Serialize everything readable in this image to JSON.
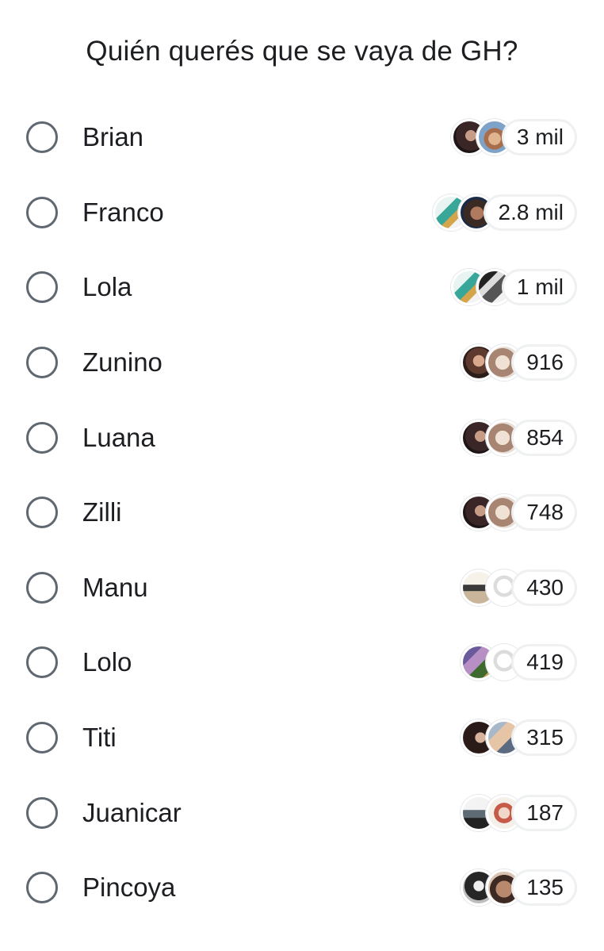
{
  "poll": {
    "question": "Quién querés que se vaya de GH?",
    "options": [
      {
        "label": "Brian",
        "count": "3 mil",
        "avatars": [
          "dark-woman",
          "blonde"
        ]
      },
      {
        "label": "Franco",
        "count": "2.8 mil",
        "avatars": [
          "chino",
          "kid"
        ]
      },
      {
        "label": "Lola",
        "count": "1 mil",
        "avatars": [
          "chino",
          "bw"
        ]
      },
      {
        "label": "Zunino",
        "count": "916",
        "avatars": [
          "brown-woman",
          "sand"
        ]
      },
      {
        "label": "Luana",
        "count": "854",
        "avatars": [
          "dark-woman",
          "sand"
        ]
      },
      {
        "label": "Zilli",
        "count": "748",
        "avatars": [
          "dark-woman",
          "sand"
        ]
      },
      {
        "label": "Manu",
        "count": "430",
        "avatars": [
          "dancer",
          "silhouette"
        ]
      },
      {
        "label": "Lolo",
        "count": "419",
        "avatars": [
          "lavender",
          "silhouette"
        ]
      },
      {
        "label": "Titi",
        "count": "315",
        "avatars": [
          "dark-hair",
          "legs"
        ]
      },
      {
        "label": "Juanicar",
        "count": "187",
        "avatars": [
          "skate",
          "party"
        ]
      },
      {
        "label": "Pincoya",
        "count": "135",
        "avatars": [
          "bw-man",
          "shirtless"
        ]
      }
    ]
  }
}
